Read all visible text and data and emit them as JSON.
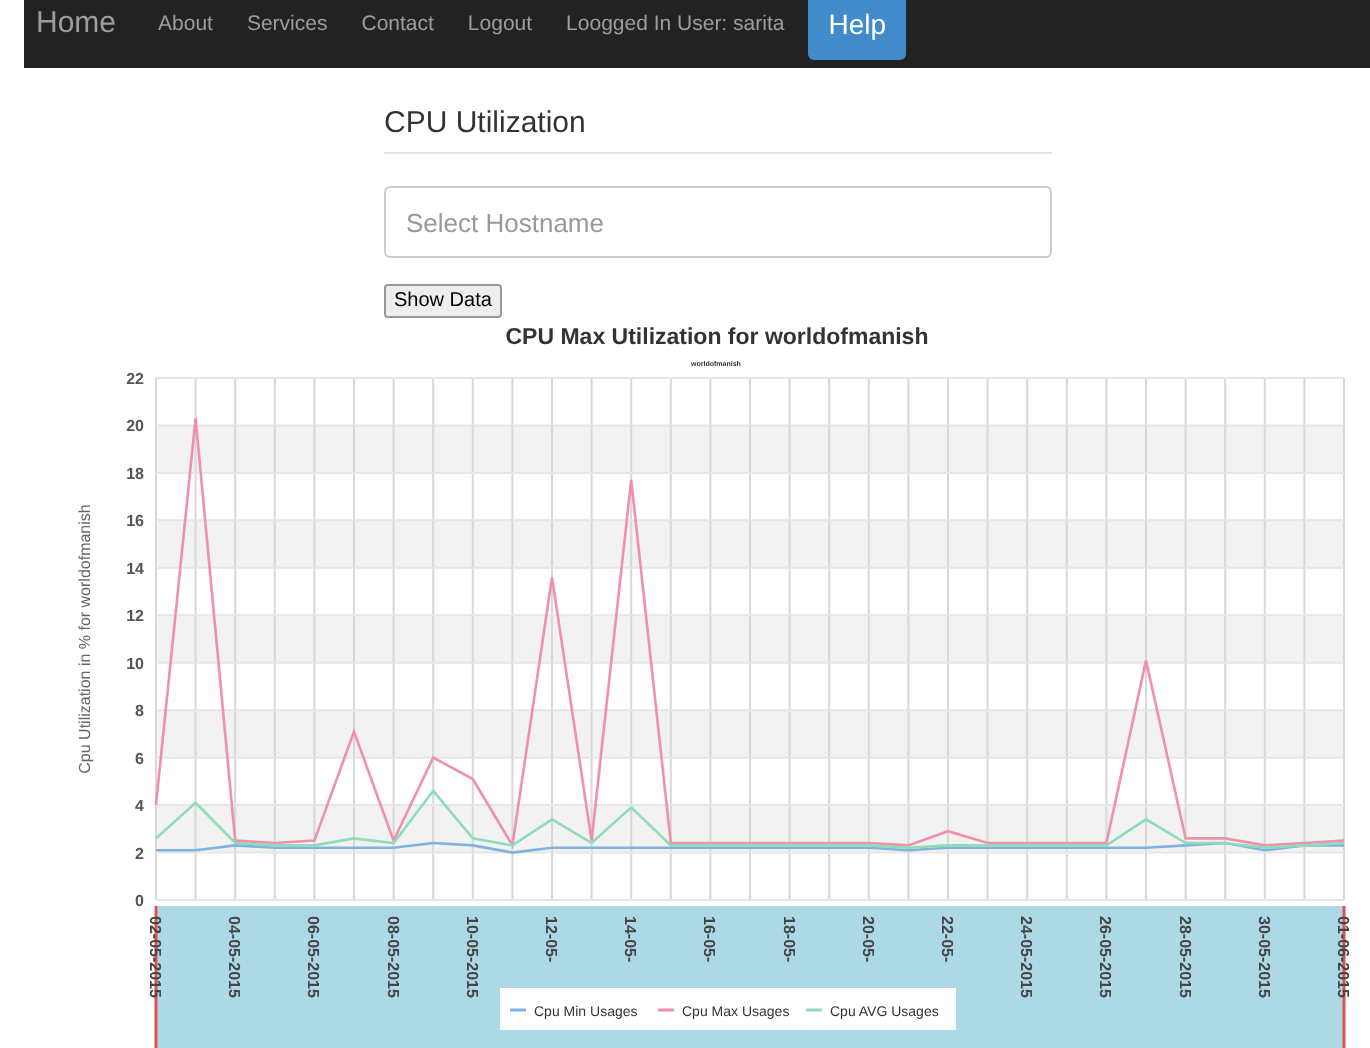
{
  "navbar": {
    "brand": "Home",
    "links": [
      "About",
      "Services",
      "Contact",
      "Logout"
    ],
    "user": "Loogged In User: sarita",
    "help_button": "Help"
  },
  "heading": "CPU Utilization",
  "hostname_field": {
    "placeholder": "Select Hostname"
  },
  "show_button": "Show Data",
  "chart": {
    "chart_data": {
      "type": "line",
      "title": "CPU Max Utilization for worldofmanish",
      "subtitle": "worldofmanish",
      "ylabel": "Cpu Utilization in % for worldofmanish",
      "categories": [
        "02-05-2015",
        null,
        "04-05-2015",
        null,
        "06-05-2015",
        null,
        "08-05-2015",
        null,
        "10-05-2015",
        null,
        "12-05-",
        null,
        "14-05-",
        null,
        "16-05-",
        null,
        "18-05-",
        null,
        "20-05-",
        null,
        "22-05-",
        null,
        "24-05-2015",
        null,
        "26-05-2015",
        null,
        "28-05-2015",
        null,
        "30-05-2015",
        null,
        "01-06-2015"
      ],
      "grid": true,
      "legend": "bottom",
      "ylim": [
        0,
        22
      ],
      "yticks": [
        0,
        2,
        4,
        6,
        8,
        10,
        12,
        14,
        16,
        18,
        20,
        22
      ],
      "series": [
        {
          "name": "Cpu Min Usages",
          "color": "#7fb3e0",
          "values": [
            2.1,
            2.1,
            2.3,
            2.2,
            2.2,
            2.2,
            2.2,
            2.4,
            2.3,
            2.0,
            2.2,
            2.2,
            2.2,
            2.2,
            2.2,
            2.2,
            2.2,
            2.2,
            2.2,
            2.1,
            2.2,
            2.2,
            2.2,
            2.2,
            2.2,
            2.2,
            2.3,
            2.4,
            2.1,
            2.3,
            2.3
          ]
        },
        {
          "name": "Cpu Max Usages",
          "color": "#f08fb0",
          "values": [
            4,
            20.3,
            2.5,
            2.4,
            2.5,
            7.1,
            2.5,
            6,
            5.1,
            2.3,
            13.6,
            2.5,
            17.7,
            2.4,
            2.4,
            2.4,
            2.4,
            2.4,
            2.4,
            2.3,
            2.9,
            2.4,
            2.4,
            2.4,
            2.4,
            10.1,
            2.6,
            2.6,
            2.3,
            2.4,
            2.5
          ]
        },
        {
          "name": "Cpu AVG Usages",
          "color": "#8fdcb9",
          "values": [
            2.6,
            4.1,
            2.4,
            2.3,
            2.3,
            2.6,
            2.4,
            4.6,
            2.6,
            2.3,
            3.4,
            2.4,
            3.9,
            2.3,
            2.3,
            2.3,
            2.3,
            2.3,
            2.3,
            2.2,
            2.3,
            2.3,
            2.3,
            2.3,
            2.3,
            3.4,
            2.4,
            2.4,
            2.2,
            2.3,
            2.4
          ]
        }
      ]
    }
  }
}
